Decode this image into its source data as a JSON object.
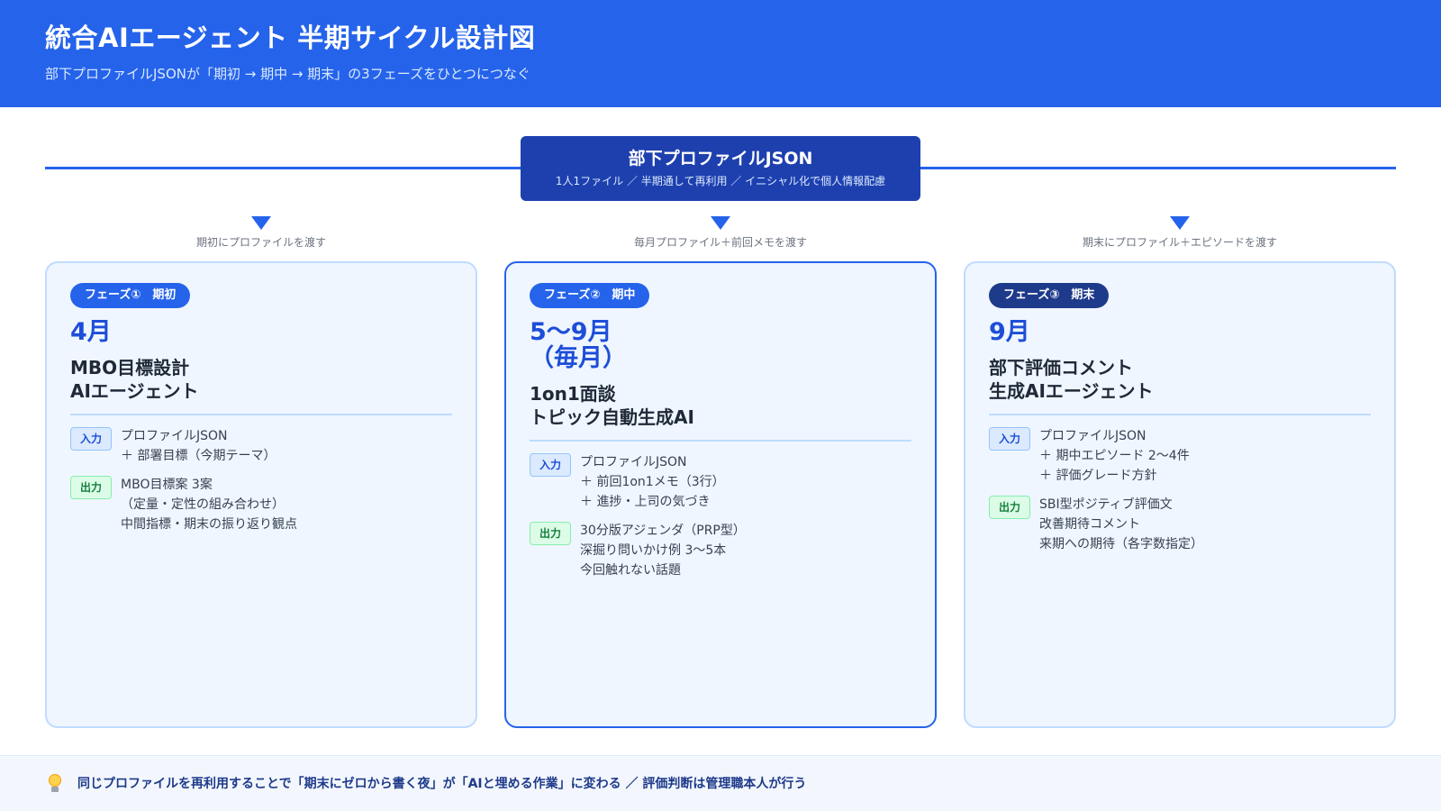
{
  "header": {
    "title": "統合AIエージェント 半期サイクル設計図",
    "subtitle": "部下プロファイルJSONが「期初 → 期中 → 期末」の3フェーズをひとつにつなぐ"
  },
  "profile": {
    "title": "部下プロファイルJSON",
    "description": "1人1ファイル ／ 半期通して再利用 ／ イニシャル化で個人情報配慮"
  },
  "connectors": [
    {
      "label": "期初にプロファイルを渡す"
    },
    {
      "label": "毎月プロファイル＋前回メモを渡す"
    },
    {
      "label": "期末にプロファイル＋エピソードを渡す"
    }
  ],
  "phases": [
    {
      "badge": "フェーズ①　期初",
      "month": "4月",
      "title": "MBO目標設計\nAIエージェント",
      "input_label": "入力",
      "input": "プロファイルJSON\n＋ 部署目標（今期テーマ）",
      "output_label": "出力",
      "output": "MBO目標案 3案\n（定量・定性の組み合わせ）\n中間指標・期末の振り返り観点"
    },
    {
      "badge": "フェーズ②　期中",
      "month": "5〜9月\n（毎月）",
      "title": "1on1面談\nトピック自動生成AI",
      "input_label": "入力",
      "input": "プロファイルJSON\n＋ 前回1on1メモ（3行）\n＋ 進捗・上司の気づき",
      "output_label": "出力",
      "output": "30分版アジェンダ（PRP型）\n深掘り問いかけ例 3〜5本\n今回触れない話題"
    },
    {
      "badge": "フェーズ③　期末",
      "month": "9月",
      "title": "部下評価コメント\n生成AIエージェント",
      "input_label": "入力",
      "input": "プロファイルJSON\n＋ 期中エピソード 2〜4件\n＋ 評価グレード方針",
      "output_label": "出力",
      "output": "SBI型ポジティブ評価文\n改善期待コメント\n来期への期待（各字数指定）"
    }
  ],
  "footer": {
    "icon": "lightbulb-icon",
    "text": "同じプロファイルを再利用することで「期末にゼロから書く夜」が「AIと埋める作業」に変わる ／ 評価判断は管理職本人が行う"
  },
  "colors": {
    "primary": "#2563eb",
    "dark": "#1e40af",
    "navy": "#1e3a8a",
    "card_bg": "#eff6ff",
    "card_border": "#bfdbfe"
  }
}
